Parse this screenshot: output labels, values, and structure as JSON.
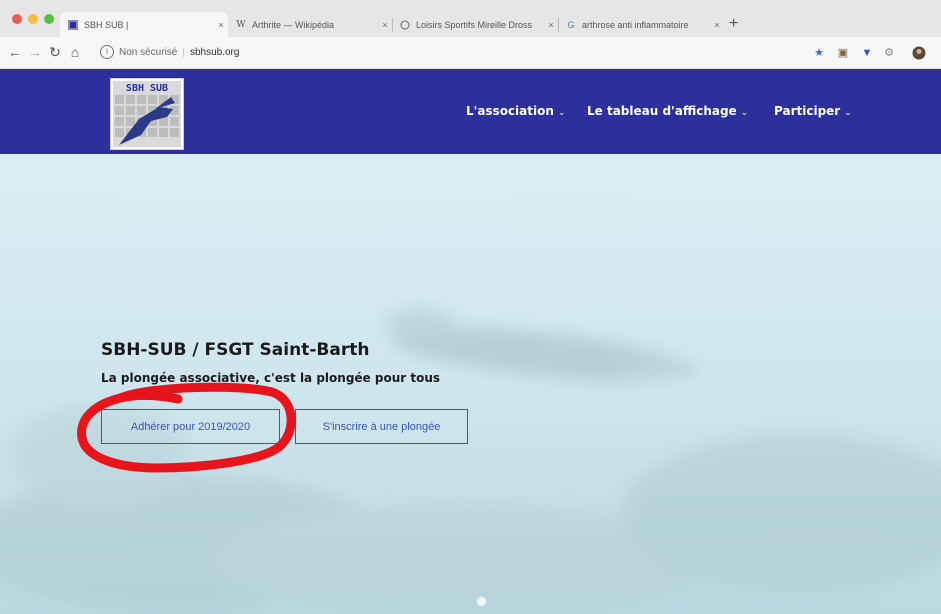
{
  "browser": {
    "tabs": [
      {
        "title": "SBH SUB |",
        "close": "×"
      },
      {
        "title": "Arthrite — Wikipédia",
        "close": "×"
      },
      {
        "title": "Loisirs Sportifs Mireille Dross",
        "close": "×"
      },
      {
        "title": "arthrose anti inflammatoire",
        "close": "×"
      }
    ],
    "new_tab": "+",
    "address": {
      "security": "Non sécurisé",
      "url": "sbhsub.org"
    }
  },
  "site": {
    "logo_text": "SBH SUB",
    "nav": [
      {
        "label": "L'association"
      },
      {
        "label": "Le tableau d'affichage"
      },
      {
        "label": "Participer"
      }
    ]
  },
  "hero": {
    "title": "SBH-SUB / FSGT Saint-Barth",
    "subtitle": "La plongée associative, c'est la plongée pour tous",
    "buttons": [
      {
        "label": "Adhérer pour 2019/2020"
      },
      {
        "label": "S'inscrire à une plongée"
      }
    ]
  },
  "colors": {
    "header": "#2c2f9c",
    "button_border": "#3a55b8",
    "annotation": "#e8141c"
  }
}
